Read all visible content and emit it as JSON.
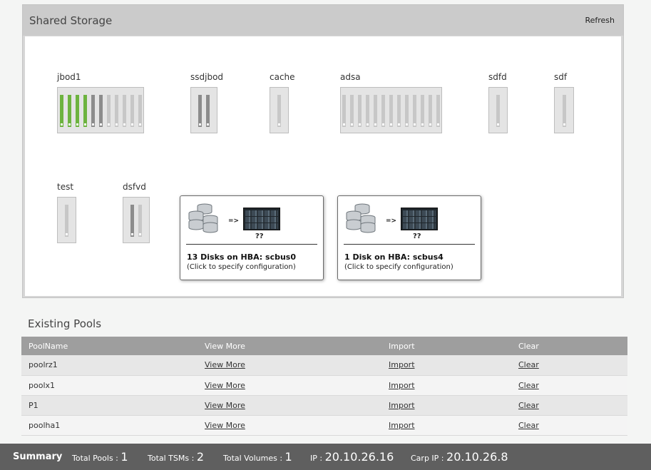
{
  "shared_storage": {
    "title": "Shared Storage",
    "refresh_label": "Refresh",
    "jbods": [
      {
        "name": "jbod1",
        "slots": [
          "green",
          "green",
          "green",
          "green",
          "dark",
          "dark",
          "light",
          "light",
          "light",
          "light",
          "light"
        ]
      },
      {
        "name": "ssdjbod",
        "slots": [
          "dark",
          "dark"
        ]
      },
      {
        "name": "cache",
        "slots": [
          "light"
        ]
      },
      {
        "name": "adsa",
        "slots": [
          "light",
          "light",
          "light",
          "light",
          "light",
          "light",
          "light",
          "light",
          "light",
          "light",
          "light",
          "light",
          "light"
        ]
      },
      {
        "name": "sdfd",
        "slots": [
          "light"
        ]
      },
      {
        "name": "sdf",
        "slots": [
          "light"
        ]
      },
      {
        "name": "test",
        "slots": [
          "light"
        ]
      },
      {
        "name": "dsfvd",
        "slots": [
          "dark",
          "light"
        ]
      }
    ],
    "hba_cards": [
      {
        "arrow": "=>",
        "unknown": "??",
        "title": "13 Disks on HBA: scbus0",
        "subtitle": "(Click to specify configuration)"
      },
      {
        "arrow": "=>",
        "unknown": "??",
        "title": "1 Disk on HBA: scbus4",
        "subtitle": "(Click to specify configuration)"
      }
    ]
  },
  "pools": {
    "title": "Existing Pools",
    "columns": [
      "PoolName",
      "View More",
      "Import",
      "Clear"
    ],
    "rows": [
      {
        "name": "poolrz1",
        "view": "View More",
        "import": "Import",
        "clear": "Clear"
      },
      {
        "name": "poolx1",
        "view": "View More",
        "import": "Import",
        "clear": "Clear"
      },
      {
        "name": "P1",
        "view": "View More",
        "import": "Import",
        "clear": "Clear"
      },
      {
        "name": "poolha1",
        "view": "View More",
        "import": "Import",
        "clear": "Clear"
      }
    ]
  },
  "summary": {
    "heading": "Summary",
    "total_pools_label": "Total Pools :",
    "total_pools": "1",
    "total_tsms_label": "Total TSMs :",
    "total_tsms": "2",
    "total_volumes_label": "Total Volumes :",
    "total_volumes": "1",
    "ip_label": "IP :",
    "ip": "20.10.26.16",
    "carp_ip_label": "Carp IP :",
    "carp_ip": "20.10.26.8"
  },
  "colors": {
    "slot_green": "#6db33f",
    "slot_dark": "#8c8c8c",
    "slot_light": "#c7c7c7",
    "summary_bar": "#5f5f5f",
    "table_header": "#9e9e9e"
  }
}
